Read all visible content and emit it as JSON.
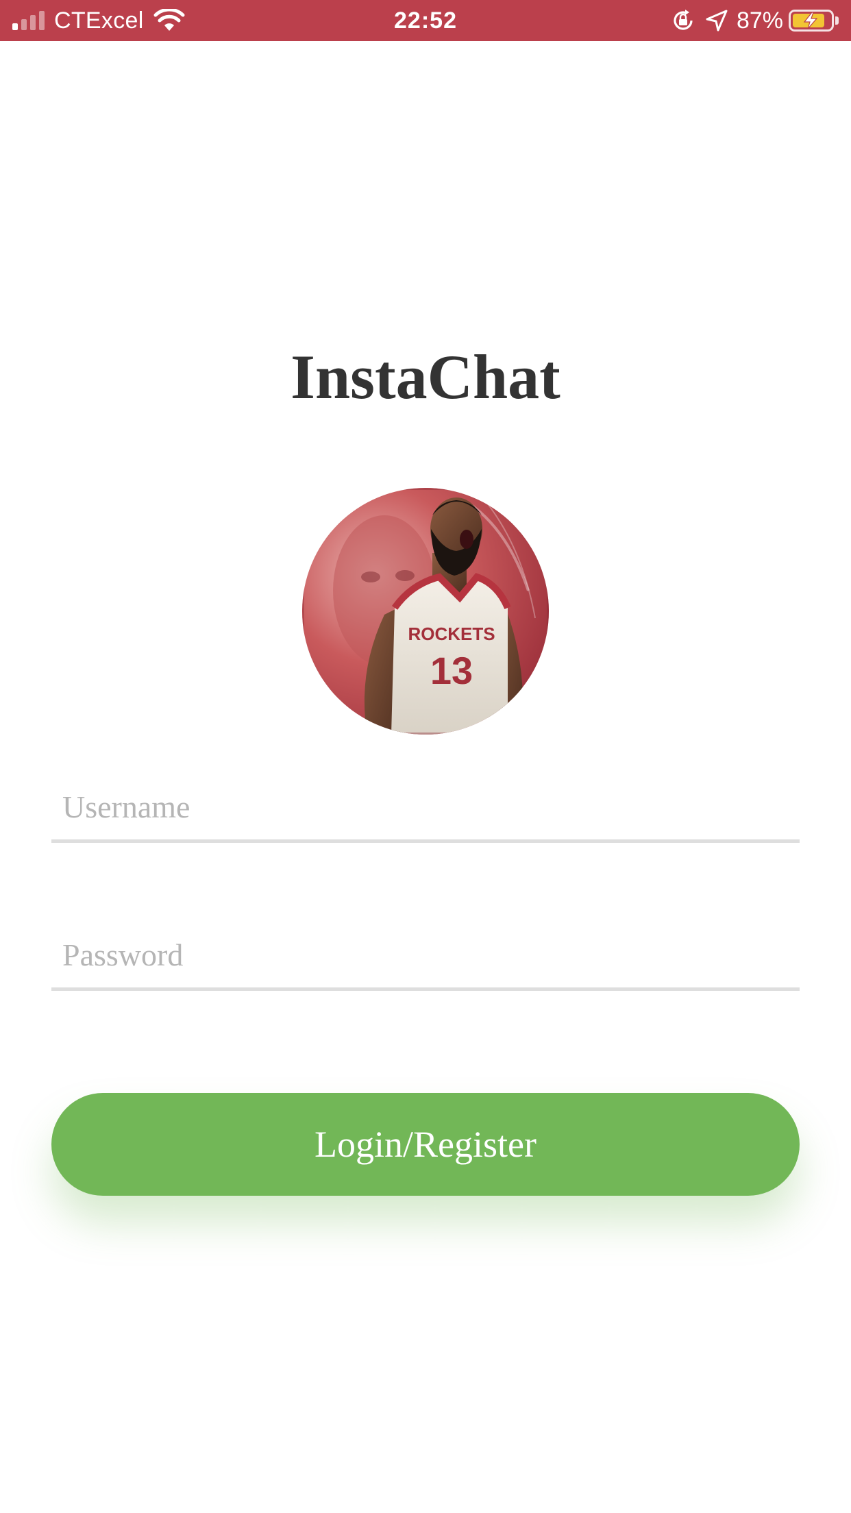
{
  "status_bar": {
    "carrier": "CTExcel",
    "time": "22:52",
    "battery_percent": "87%",
    "signal_bars_active": 1,
    "signal_bars_total": 4,
    "icons": [
      "signal-icon",
      "wifi-icon",
      "orientation-lock-icon",
      "location-arrow-icon",
      "battery-charging-icon"
    ],
    "colors": {
      "background": "#bb404c",
      "battery_fill": "#f2c534"
    }
  },
  "main": {
    "title": "InstaChat",
    "avatar": {
      "description": "profile-photo",
      "jersey_text": "ROCKETS",
      "jersey_number": "13"
    },
    "username_field": {
      "placeholder": "Username",
      "value": ""
    },
    "password_field": {
      "placeholder": "Password",
      "value": ""
    },
    "login_button": {
      "label": "Login/Register",
      "color": "#72b757"
    }
  }
}
